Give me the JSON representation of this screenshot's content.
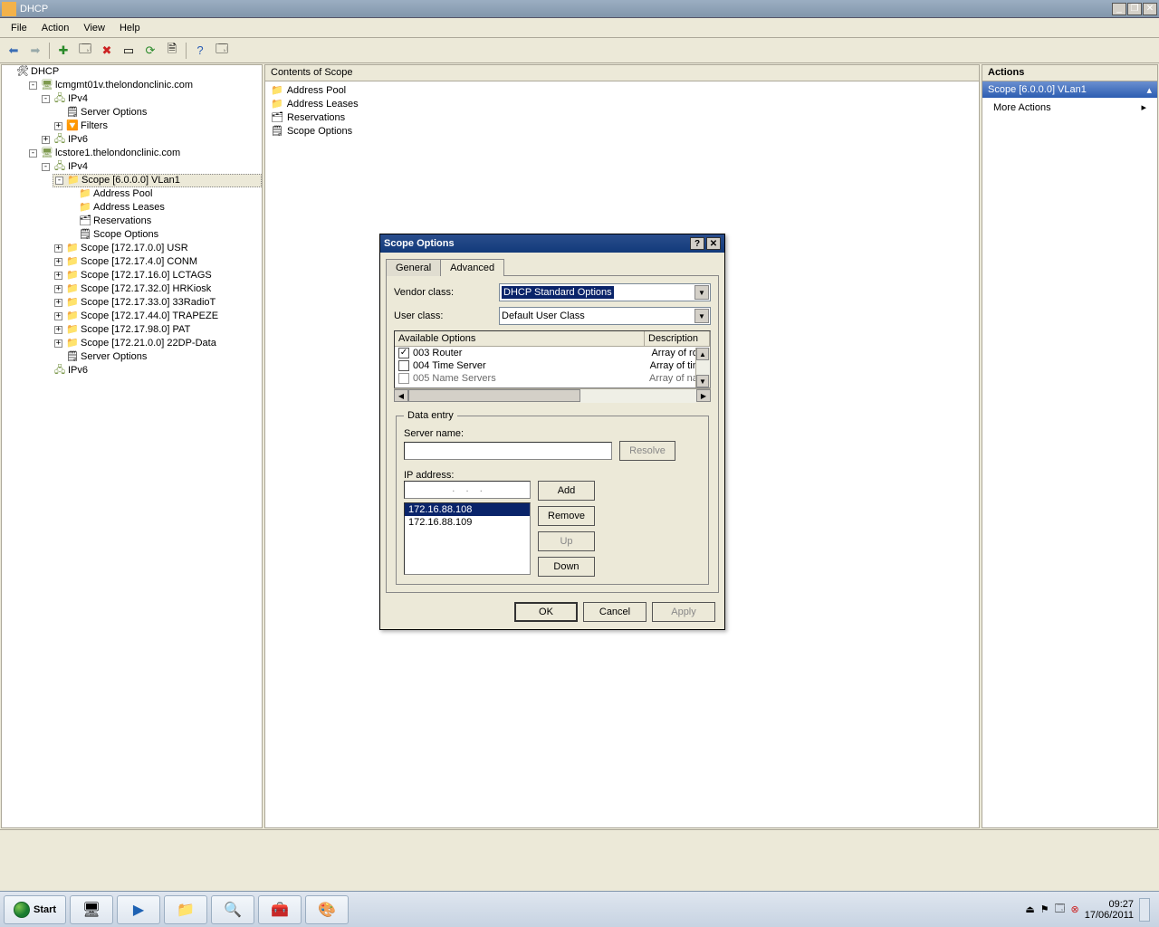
{
  "window": {
    "title": "DHCP"
  },
  "menus": [
    "File",
    "Action",
    "View",
    "Help"
  ],
  "tree": {
    "root": "DHCP",
    "server1": "lcmgmt01v.thelondonclinic.com",
    "ipv4": "IPv4",
    "server_options": "Server Options",
    "filters": "Filters",
    "ipv6": "IPv6",
    "server2": "lcstore1.thelondonclinic.com",
    "scope_sel": "Scope [6.0.0.0] VLan1",
    "scope_children": [
      "Address Pool",
      "Address Leases",
      "Reservations",
      "Scope Options"
    ],
    "scopes": [
      "Scope [172.17.0.0] USR",
      "Scope [172.17.4.0] CONM",
      "Scope [172.17.16.0] LCTAGS",
      "Scope [172.17.32.0] HRKiosk",
      "Scope [172.17.33.0] 33RadioT",
      "Scope [172.17.44.0] TRAPEZE",
      "Scope [172.17.98.0] PAT",
      "Scope [172.21.0.0] 22DP-Data"
    ]
  },
  "content": {
    "header": "Contents of Scope",
    "items": [
      "Address Pool",
      "Address Leases",
      "Reservations",
      "Scope Options"
    ]
  },
  "actions": {
    "header": "Actions",
    "scope": "Scope [6.0.0.0] VLan1",
    "more": "More Actions"
  },
  "dialog": {
    "title": "Scope Options",
    "tab_general": "General",
    "tab_advanced": "Advanced",
    "vendor_label": "Vendor class:",
    "vendor_value": "DHCP Standard Options",
    "user_label": "User class:",
    "user_value": "Default User Class",
    "col_opts": "Available Options",
    "col_desc": "Description",
    "options": [
      {
        "checked": true,
        "name": "003 Router",
        "desc": "Array of rout"
      },
      {
        "checked": false,
        "name": "004 Time Server",
        "desc": "Array of time"
      },
      {
        "checked": false,
        "name": "005 Name Servers",
        "desc": "Array of nam"
      }
    ],
    "data_entry": "Data entry",
    "server_name": "Server name:",
    "resolve": "Resolve",
    "ip_label": "IP address:",
    "add": "Add",
    "remove": "Remove",
    "up": "Up",
    "down": "Down",
    "ips": [
      "172.16.88.108",
      "172.16.88.109"
    ],
    "ok": "OK",
    "cancel": "Cancel",
    "apply": "Apply"
  },
  "taskbar": {
    "start": "Start",
    "time": "09:27",
    "date": "17/06/2011"
  }
}
